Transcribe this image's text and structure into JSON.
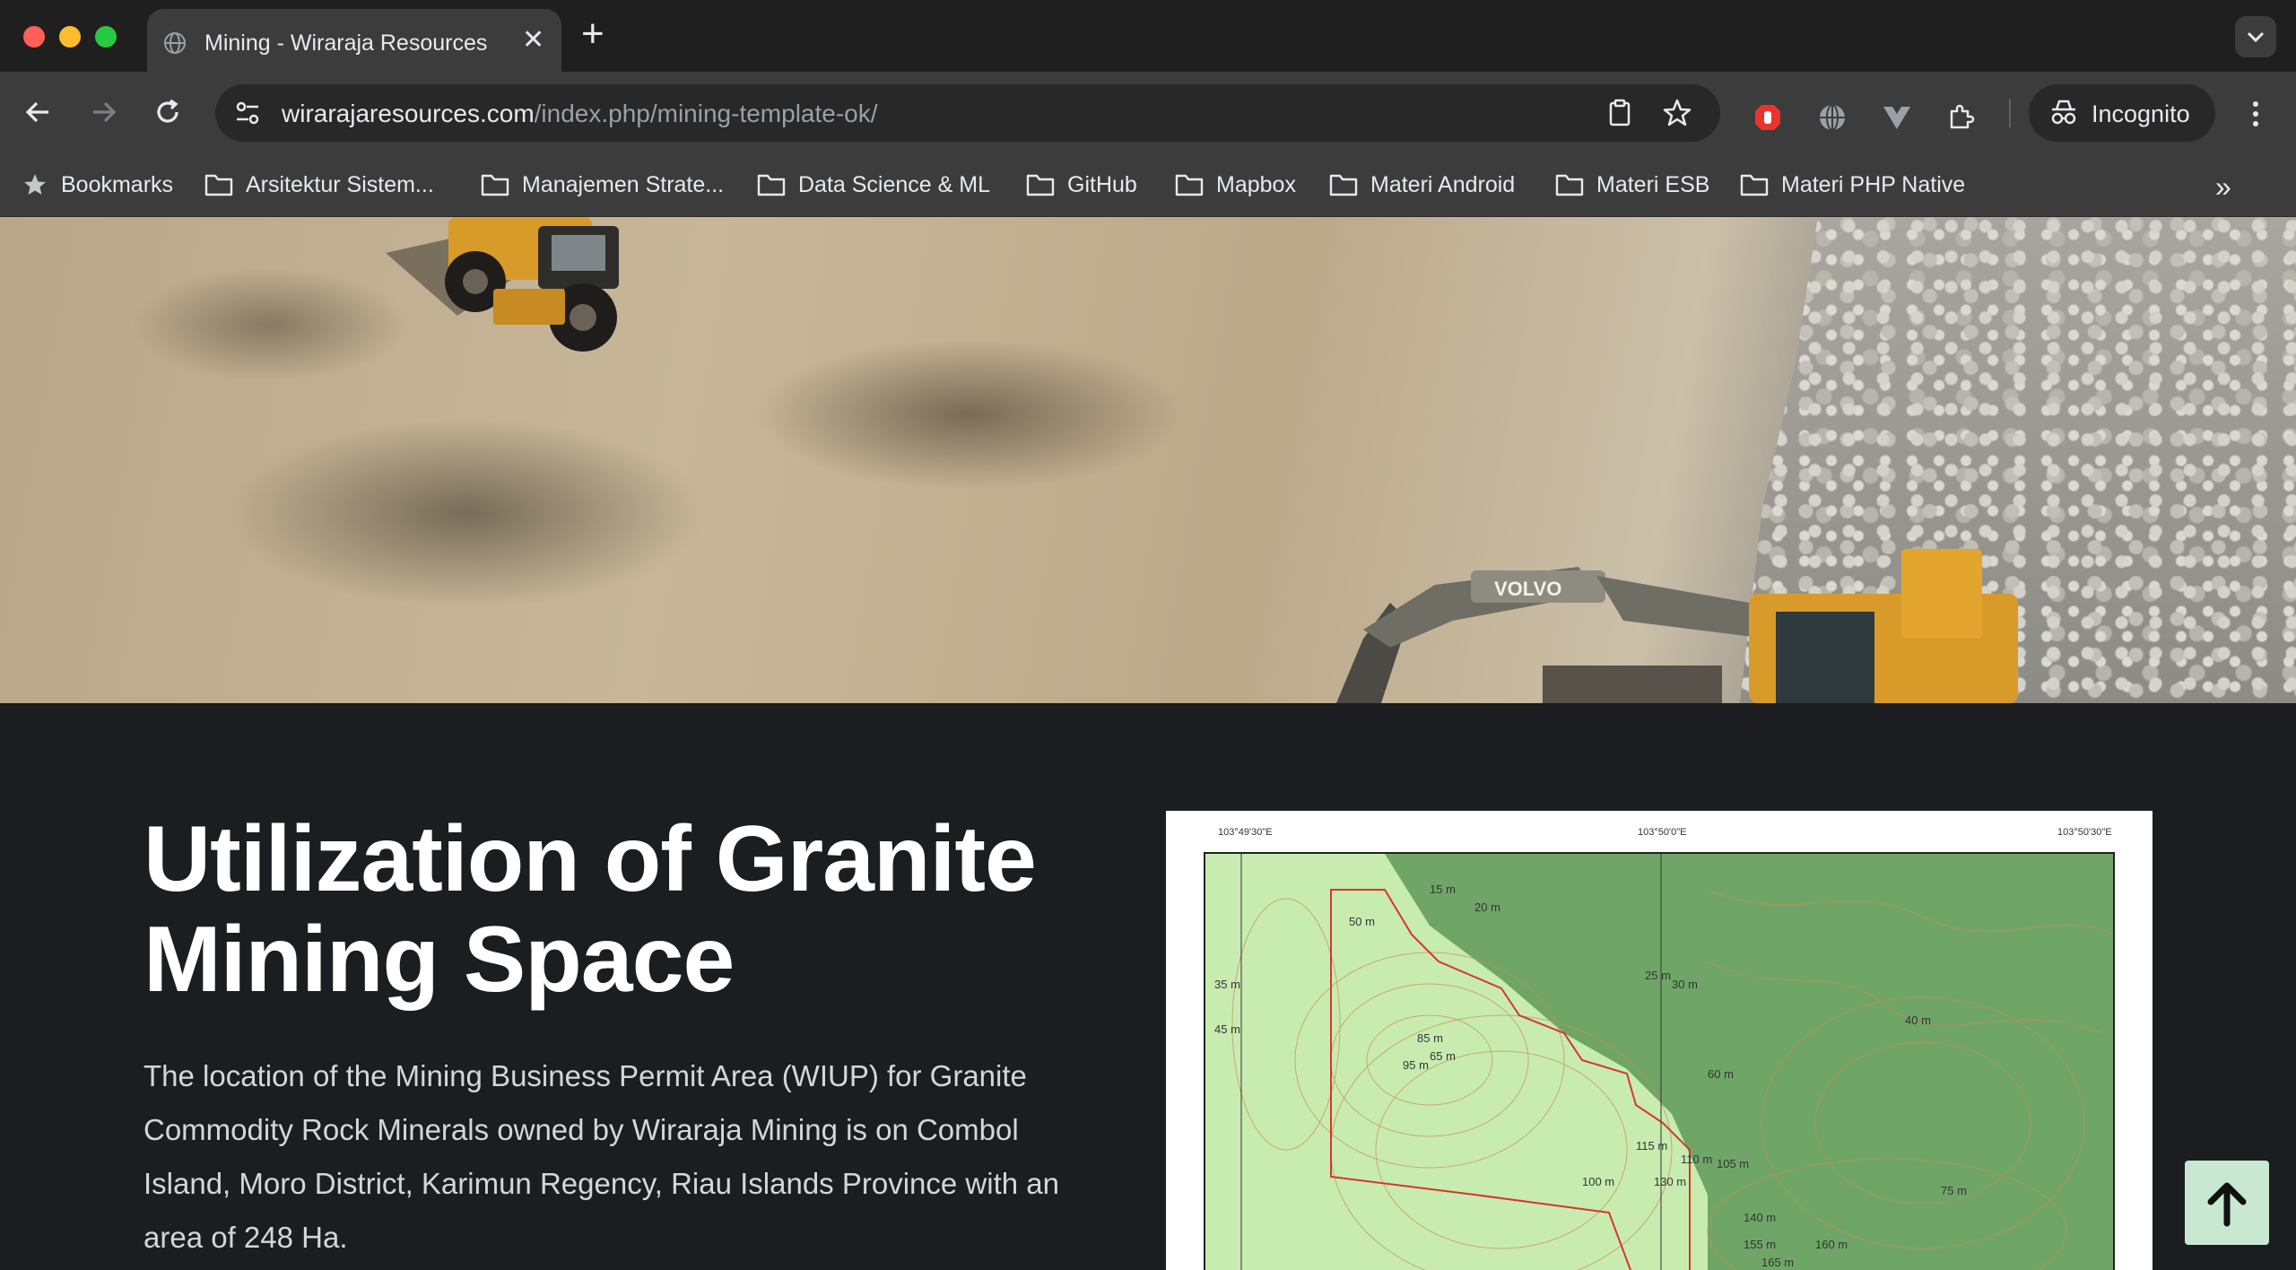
{
  "browser": {
    "tab_title": "Mining - Wiraraja Resources",
    "url_host": "wirarajaresources.com",
    "url_path": "/index.php/mining-template-ok/",
    "incognito_label": "Incognito"
  },
  "bookmarks": {
    "items": [
      "Bookmarks",
      "Arsitektur Sistem...",
      "Manajemen Strate...",
      "Data Science & ML",
      "GitHub",
      "Mapbox",
      "Materi Android",
      "Materi ESB",
      "Materi PHP Native"
    ],
    "more": "»"
  },
  "hero": {
    "excavator_brand": "VOLVO"
  },
  "main": {
    "heading_line1": "Utilization of Granite",
    "heading_line2": "Mining Space",
    "description": "The location of the Mining Business Permit Area (WIUP) for Granite Commodity Rock Minerals owned by Wiraraja Mining is on Combol Island, Moro District, Karimun Regency, Riau Islands Province with an area of 248 Ha."
  },
  "map": {
    "lon_labels": [
      "103°49'30\"E",
      "103°50'0\"E",
      "103°50'30\"E"
    ],
    "contour_labels": [
      "15 m",
      "20 m",
      "25 m",
      "30 m",
      "35 m",
      "40 m",
      "45 m",
      "50 m",
      "60 m",
      "65 m",
      "75 m",
      "85 m",
      "95 m",
      "100 m",
      "105 m",
      "110 m",
      "115 m",
      "130 m",
      "140 m",
      "155 m",
      "160 m",
      "165 m"
    ]
  },
  "colors": {
    "page_bg": "#1b1d20",
    "accent_button": "#c9e8d2",
    "map_land_light": "#c8ecb0",
    "map_land_dark": "#6fa668",
    "permit_outline": "#d9352b"
  }
}
